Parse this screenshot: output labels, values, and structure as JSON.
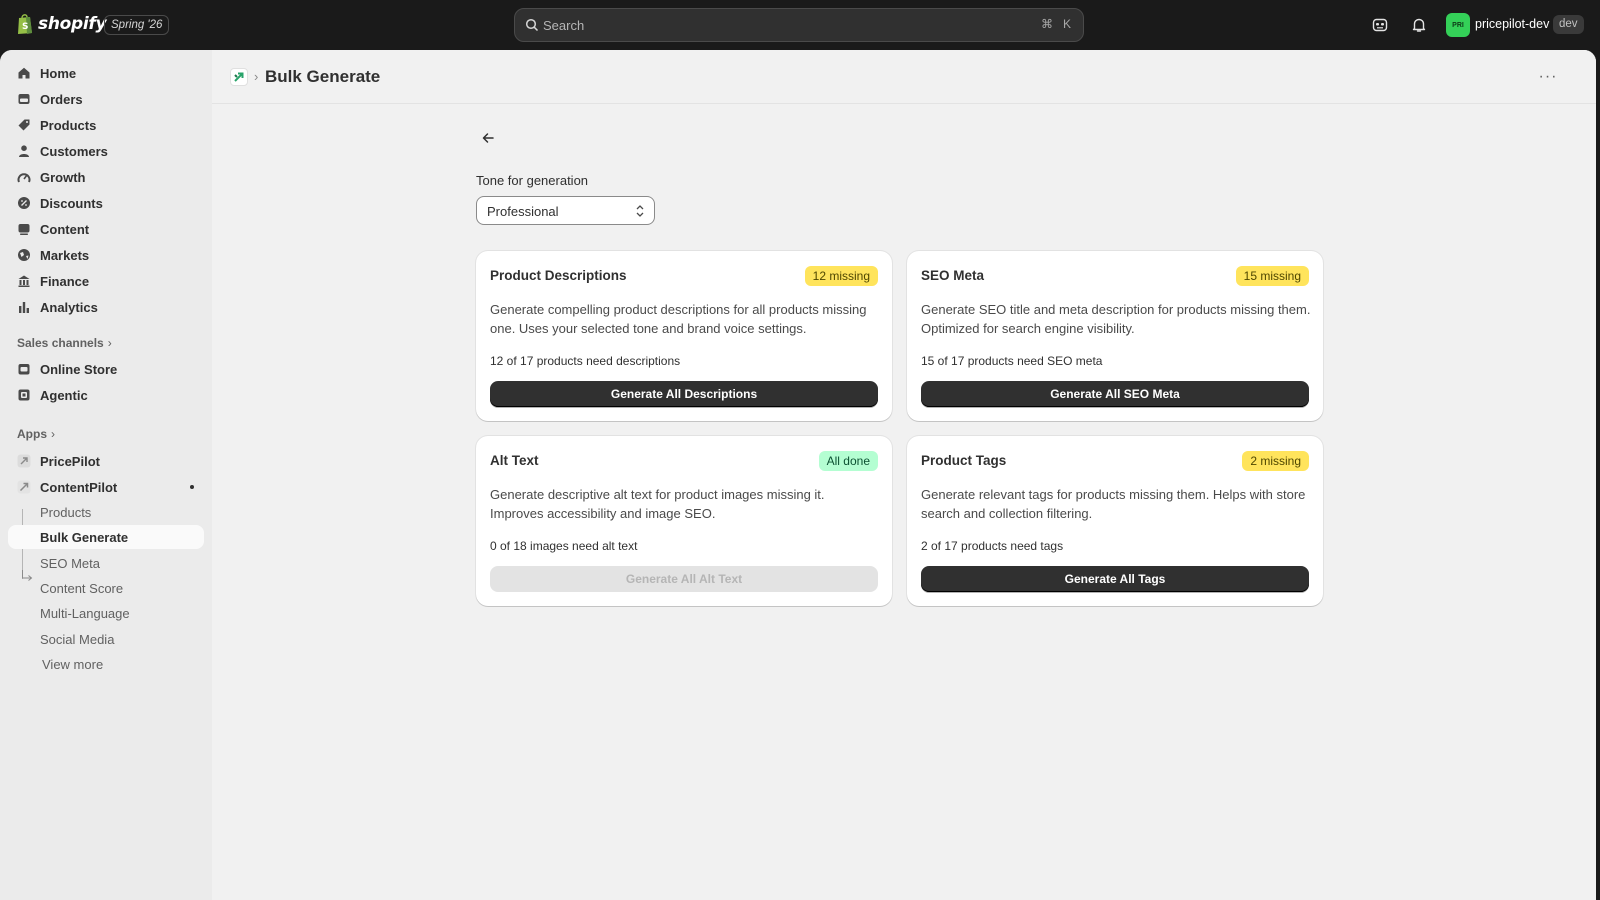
{
  "topbar": {
    "logo_text": "shopify",
    "edition": "Spring '26",
    "search_placeholder": "Search",
    "shortcut_mod": "⌘",
    "shortcut_key": "K",
    "avatar_initials": "PRI",
    "store_name": "pricepilot-dev",
    "env_badge": "dev"
  },
  "sidebar": {
    "main_items": [
      {
        "label": "Home",
        "icon": "home-icon"
      },
      {
        "label": "Orders",
        "icon": "orders-icon"
      },
      {
        "label": "Products",
        "icon": "tag-icon"
      },
      {
        "label": "Customers",
        "icon": "person-icon"
      },
      {
        "label": "Growth",
        "icon": "growth-icon"
      },
      {
        "label": "Discounts",
        "icon": "discount-icon"
      },
      {
        "label": "Content",
        "icon": "content-icon"
      },
      {
        "label": "Markets",
        "icon": "globe-icon"
      },
      {
        "label": "Finance",
        "icon": "bank-icon"
      },
      {
        "label": "Analytics",
        "icon": "chart-bar-icon"
      }
    ],
    "sales_channels_title": "Sales channels",
    "sales_channels": [
      {
        "label": "Online Store",
        "icon": "store-icon"
      },
      {
        "label": "Agentic",
        "icon": "agentic-icon"
      }
    ],
    "apps_title": "Apps",
    "apps": [
      {
        "label": "PricePilot"
      },
      {
        "label": "ContentPilot"
      }
    ],
    "app_sub_items": [
      {
        "label": "Products"
      },
      {
        "label": "Bulk Generate"
      },
      {
        "label": "SEO Meta"
      },
      {
        "label": "Content Score"
      },
      {
        "label": "Multi-Language"
      },
      {
        "label": "Social Media"
      },
      {
        "label": "View more"
      }
    ]
  },
  "header": {
    "title": "Bulk Generate",
    "more_label": "···"
  },
  "tone": {
    "label": "Tone for generation",
    "value": "Professional"
  },
  "cards": [
    {
      "title": "Product Descriptions",
      "badge": "12 missing",
      "badge_status": "warning",
      "description": "Generate compelling product descriptions for all products missing one. Uses your selected tone and brand voice settings.",
      "count": "12 of 17 products need descriptions",
      "button": "Generate All Descriptions",
      "button_enabled": true
    },
    {
      "title": "SEO Meta",
      "badge": "15 missing",
      "badge_status": "warning",
      "description": "Generate SEO title and meta description for products missing them. Optimized for search engine visibility.",
      "count": "15 of 17 products need SEO meta",
      "button": "Generate All SEO Meta",
      "button_enabled": true
    },
    {
      "title": "Alt Text",
      "badge": "All done",
      "badge_status": "success",
      "description": "Generate descriptive alt text for product images missing it. Improves accessibility and image SEO.",
      "count": "0 of 18 images need alt text",
      "button": "Generate All Alt Text",
      "button_enabled": false
    },
    {
      "title": "Product Tags",
      "badge": "2 missing",
      "badge_status": "warning",
      "description": "Generate relevant tags for products missing them. Helps with store search and collection filtering.",
      "count": "2 of 17 products need tags",
      "button": "Generate All Tags",
      "button_enabled": true
    }
  ],
  "colors": {
    "topbar_bg": "#1a1a1a",
    "primary_button": "#303030",
    "warning_badge": "#ffe45c",
    "success_badge": "#b4fed2",
    "avatar_bg": "#34d058"
  }
}
